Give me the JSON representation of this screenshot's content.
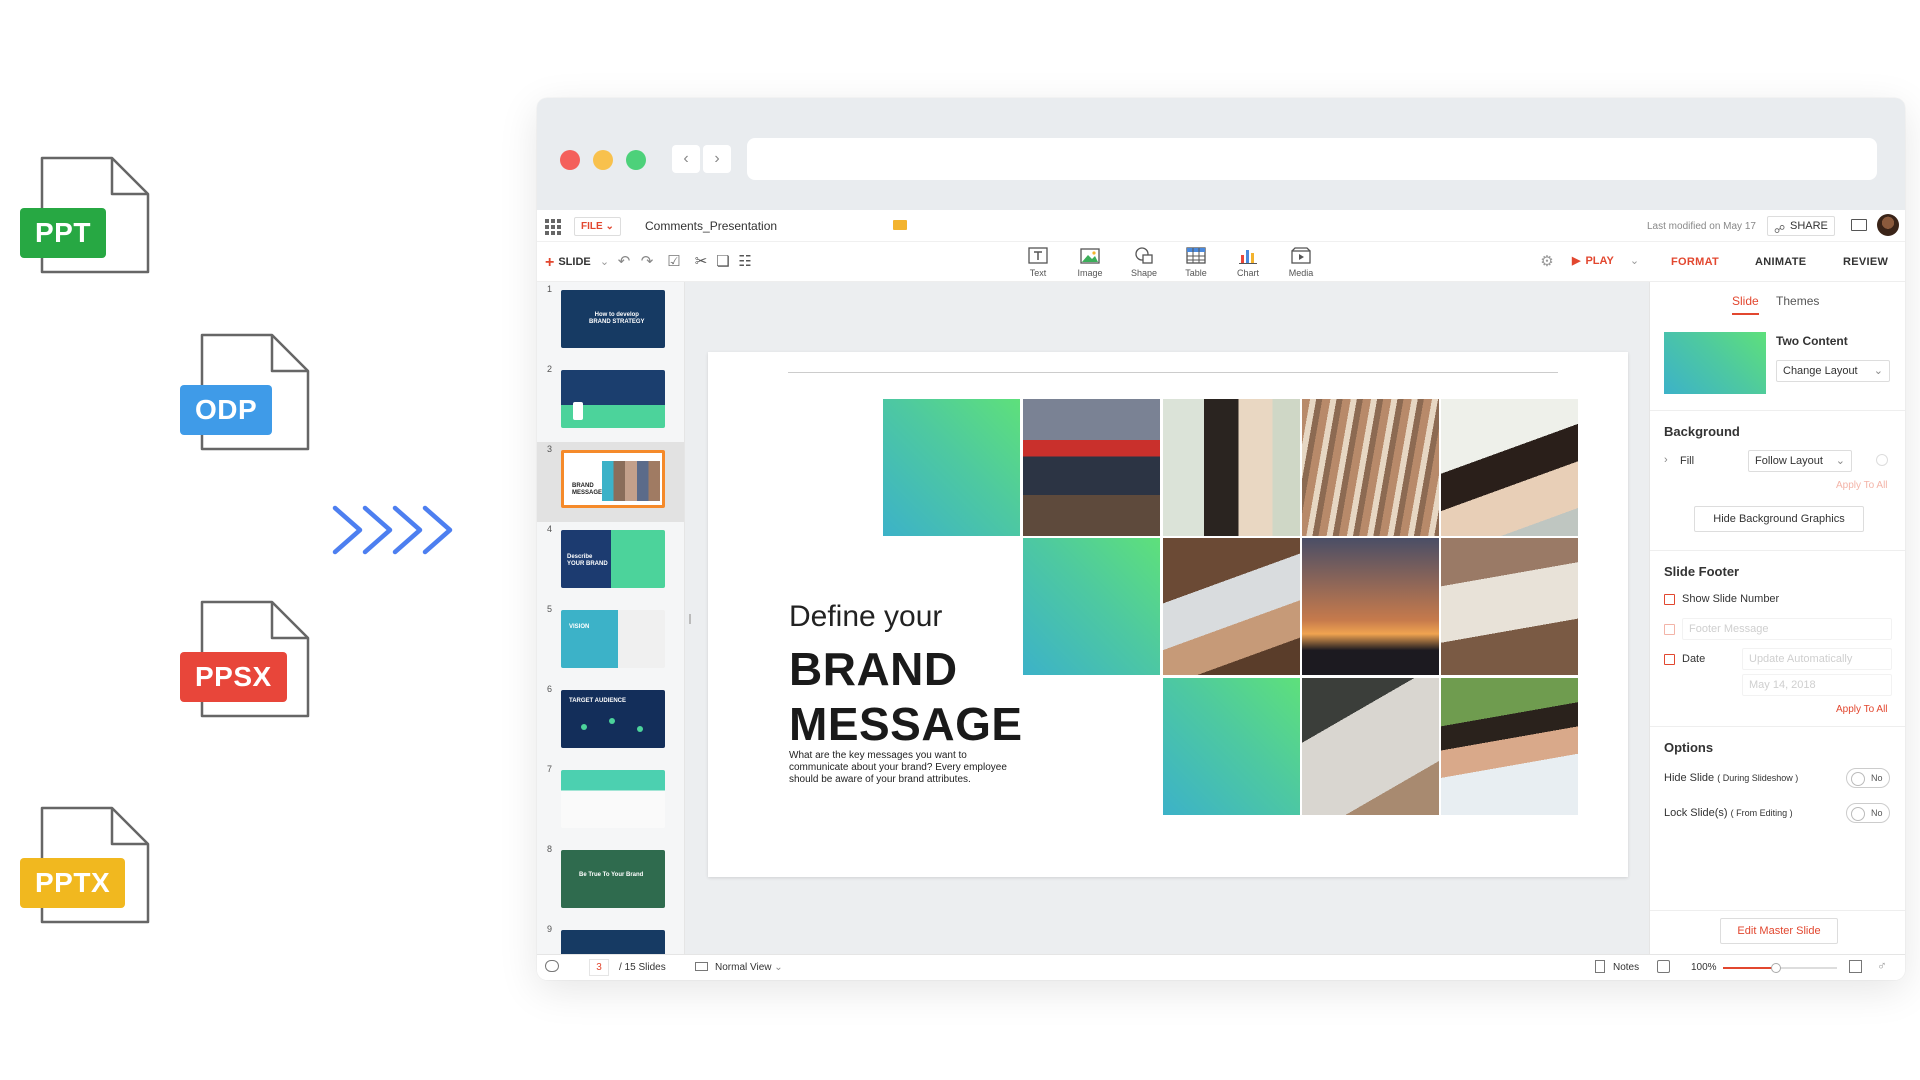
{
  "file_icons": [
    {
      "label": "PPT",
      "color": "#27a843"
    },
    {
      "label": "ODP",
      "color": "#3f9be8"
    },
    {
      "label": "PPSX",
      "color": "#e8463a"
    },
    {
      "label": "PPTX",
      "color": "#f1b81f"
    }
  ],
  "app": {
    "file_menu": "FILE",
    "doc_title": "Comments_Presentation",
    "last_modified": "Last modified on May 17",
    "share_label": "SHARE"
  },
  "toolbar": {
    "slide_label": "SLIDE",
    "insert_items": [
      "Text",
      "Image",
      "Shape",
      "Table",
      "Chart",
      "Media"
    ],
    "play_label": "PLAY",
    "panel_tabs": [
      "FORMAT",
      "ANIMATE",
      "REVIEW"
    ]
  },
  "thumbnails": [
    {
      "num": "1",
      "text": "How to develop\nBRAND STRATEGY"
    },
    {
      "num": "2",
      "text": ""
    },
    {
      "num": "3",
      "text": "BRAND\nMESSAGE"
    },
    {
      "num": "4",
      "text": "Describe\nYOUR BRAND"
    },
    {
      "num": "5",
      "text": "VISION"
    },
    {
      "num": "6",
      "text": "TARGET AUDIENCE"
    },
    {
      "num": "7",
      "text": ""
    },
    {
      "num": "8",
      "text": "Be True To Your Brand"
    },
    {
      "num": "9",
      "text": ""
    }
  ],
  "slide": {
    "heading_light": "Define your",
    "heading_bold_1": "BRAND",
    "heading_bold_2": "MESSAGE",
    "description": "What are the key messages you want to communicate about your brand? Every employee should be aware of your brand attributes."
  },
  "panel": {
    "tab_slide": "Slide",
    "tab_themes": "Themes",
    "layout_name": "Two Content",
    "change_layout": "Change Layout",
    "background_title": "Background",
    "fill_label": "Fill",
    "fill_value": "Follow Layout",
    "apply_to_all_1": "Apply To All",
    "hide_bg_graphics": "Hide Background Graphics",
    "footer_title": "Slide Footer",
    "show_slide_number": "Show Slide Number",
    "footer_message": "Footer Message",
    "date_label": "Date",
    "date_mode": "Update Automatically",
    "date_value": "May 14, 2018",
    "apply_to_all_2": "Apply To All",
    "options_title": "Options",
    "hide_slide": "Hide Slide",
    "hide_slide_note": "( During Slideshow )",
    "lock_slide": "Lock Slide(s)",
    "lock_slide_note": "( From Editing )",
    "toggle_no": "No",
    "edit_master": "Edit Master Slide"
  },
  "status": {
    "current_slide": "3",
    "total_slides": "/ 15 Slides",
    "view": "Normal View",
    "notes": "Notes",
    "zoom": "100%"
  },
  "colors": {
    "accent": "#e2472f",
    "thumb_selected": "#f58a2a",
    "gradient_start": "#3cb2c8",
    "gradient_end": "#5ee07b",
    "arrow": "#4d7ff0"
  }
}
